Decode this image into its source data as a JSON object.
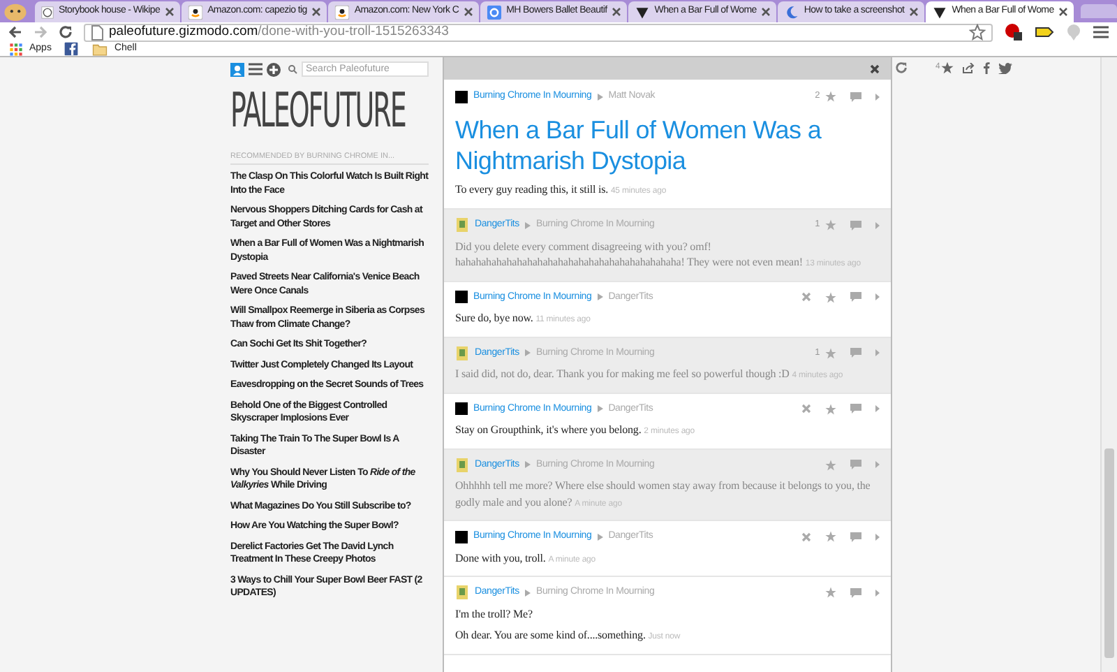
{
  "browser": {
    "tabs": [
      {
        "title": "Storybook house - Wikipe",
        "kind": "wiki",
        "selected": false
      },
      {
        "title": "Amazon.com: capezio tig",
        "kind": "amazon",
        "selected": false
      },
      {
        "title": "Amazon.com: New York C",
        "kind": "amazon",
        "selected": false
      },
      {
        "title": "MH Bowers Ballet Beautif",
        "kind": "google",
        "selected": false
      },
      {
        "title": "When a Bar Full of Wome",
        "kind": "kinja",
        "selected": false
      },
      {
        "title": "How to take a screenshot",
        "kind": "moon",
        "selected": false
      },
      {
        "title": "When a Bar Full of Wome",
        "kind": "kinja",
        "selected": true
      }
    ],
    "url_host": "paleofuture.gizmodo.com",
    "url_path": "/done-with-you-troll-1515263343",
    "bookmarks": [
      {
        "label": "Apps",
        "kind": "apps"
      },
      {
        "kind": "facebook"
      },
      {
        "label": "Chell",
        "kind": "folder"
      }
    ]
  },
  "sidebar": {
    "search_placeholder": "Search Paleofuture",
    "logo": "PALEOFUTURE",
    "recommended_label": "RECOMMENDED BY BURNING CHROME IN...",
    "items": [
      "The Clasp On This Colorful Watch Is Built Right Into the Face",
      "Nervous Shoppers Ditching Cards for Cash at Target and Other Stores",
      "When a Bar Full of Women Was a Nightmarish Dystopia",
      "Paved Streets Near California's Venice Beach Were Once Canals",
      "Will Smallpox Reemerge in Siberia as Corpses Thaw from Climate Change?",
      "Can Sochi Get Its Shit Together?",
      "Twitter Just Completely Changed Its Layout",
      "Eavesdropping on the Secret Sounds of Trees",
      "Behold One of the Biggest Controlled Skyscraper Implosions Ever",
      "Taking The Train To The Super Bowl Is A Disaster",
      "Why You Should Never Listen To *Ride of the Valkyries* While Driving",
      "What Magazines Do You Still Subscribe to?",
      "How Are You Watching the Super Bowl?",
      "Derelict Factories Get The David Lynch Treatment In These Creepy Photos",
      "3 Ways to Chill Your Super Bowl Beer FAST (2 UPDATES)"
    ]
  },
  "thread": {
    "post": {
      "author": "Burning Chrome In Mourning",
      "kind": "black",
      "reply_to": "Matt Novak",
      "stars": "2",
      "title": "When a Bar Full of Women Was a Nightmarish Dystopia",
      "body": [
        "To every guy reading this, it still is."
      ],
      "time": "45 minutes ago"
    },
    "comments": [
      {
        "author": "DangerTits",
        "kind": "image",
        "reply_to": "Burning Chrome In Mourning",
        "stars": "1",
        "deletable": false,
        "dimmed": true,
        "body": [
          "Did you delete every comment disagreeing with you? omf! hahahahahahahahahahahahahahahahahahahahahaha! They were not even mean!"
        ],
        "time": "13 minutes ago"
      },
      {
        "author": "Burning Chrome In Mourning",
        "kind": "black",
        "reply_to": "DangerTits",
        "deletable": true,
        "dimmed": false,
        "body": [
          "Sure do, bye now."
        ],
        "time": "11 minutes ago"
      },
      {
        "author": "DangerTits",
        "kind": "image",
        "reply_to": "Burning Chrome In Mourning",
        "stars": "1",
        "deletable": false,
        "dimmed": true,
        "body": [
          "I said did, not do, dear. Thank you for making me feel so powerful though :D"
        ],
        "time": "4 minutes ago"
      },
      {
        "author": "Burning Chrome In Mourning",
        "kind": "black",
        "reply_to": "DangerTits",
        "deletable": true,
        "dimmed": false,
        "body": [
          "Stay on Groupthink, it's where you belong."
        ],
        "time": "2 minutes ago"
      },
      {
        "author": "DangerTits",
        "kind": "image",
        "reply_to": "Burning Chrome In Mourning",
        "deletable": false,
        "dimmed": true,
        "body": [
          "Ohhhhh tell me more? Where else should women stay away from because it belongs to you, the godly male and you alone?"
        ],
        "time": "A minute ago"
      },
      {
        "author": "Burning Chrome In Mourning",
        "kind": "black",
        "reply_to": "DangerTits",
        "deletable": true,
        "dimmed": false,
        "body": [
          "Done with you, troll."
        ],
        "time": "A minute ago"
      },
      {
        "author": "DangerTits",
        "kind": "image",
        "reply_to": "Burning Chrome In Mourning",
        "deletable": false,
        "dimmed": false,
        "body": [
          "I'm the troll? Me?",
          "Oh dear. You are some kind of....something."
        ],
        "time": "Just now"
      }
    ]
  },
  "share": {
    "count": "4"
  }
}
